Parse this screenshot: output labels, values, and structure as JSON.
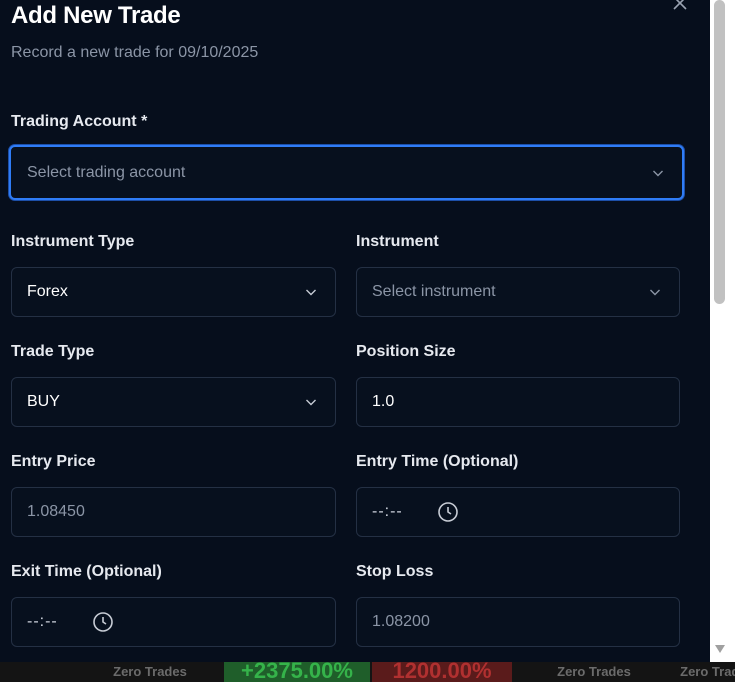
{
  "dialog": {
    "title": "Add New Trade",
    "subtitle": "Record a new trade for 09/10/2025",
    "close_icon": "close-icon"
  },
  "fields": {
    "trading_account": {
      "label": "Trading Account *",
      "placeholder": "Select trading account"
    },
    "instrument_type": {
      "label": "Instrument Type",
      "value": "Forex"
    },
    "instrument": {
      "label": "Instrument",
      "placeholder": "Select instrument"
    },
    "trade_type": {
      "label": "Trade Type",
      "value": "BUY"
    },
    "position_size": {
      "label": "Position Size",
      "value": "1.0"
    },
    "entry_price": {
      "label": "Entry Price",
      "placeholder": "1.08450"
    },
    "entry_time": {
      "label": "Entry Time (Optional)",
      "value": "--:--"
    },
    "exit_time": {
      "label": "Exit Time (Optional)",
      "value": "--:--"
    },
    "stop_loss": {
      "label": "Stop Loss",
      "placeholder": "1.08200"
    }
  },
  "background": {
    "cells": [
      "Zero Trades",
      "+2375.00%",
      "1200.00%",
      "Zero Trades",
      "Zero Trades"
    ]
  },
  "colors": {
    "accent": "#2f7cf6",
    "modal_bg": "#060e1c",
    "field_border": "#243044"
  }
}
